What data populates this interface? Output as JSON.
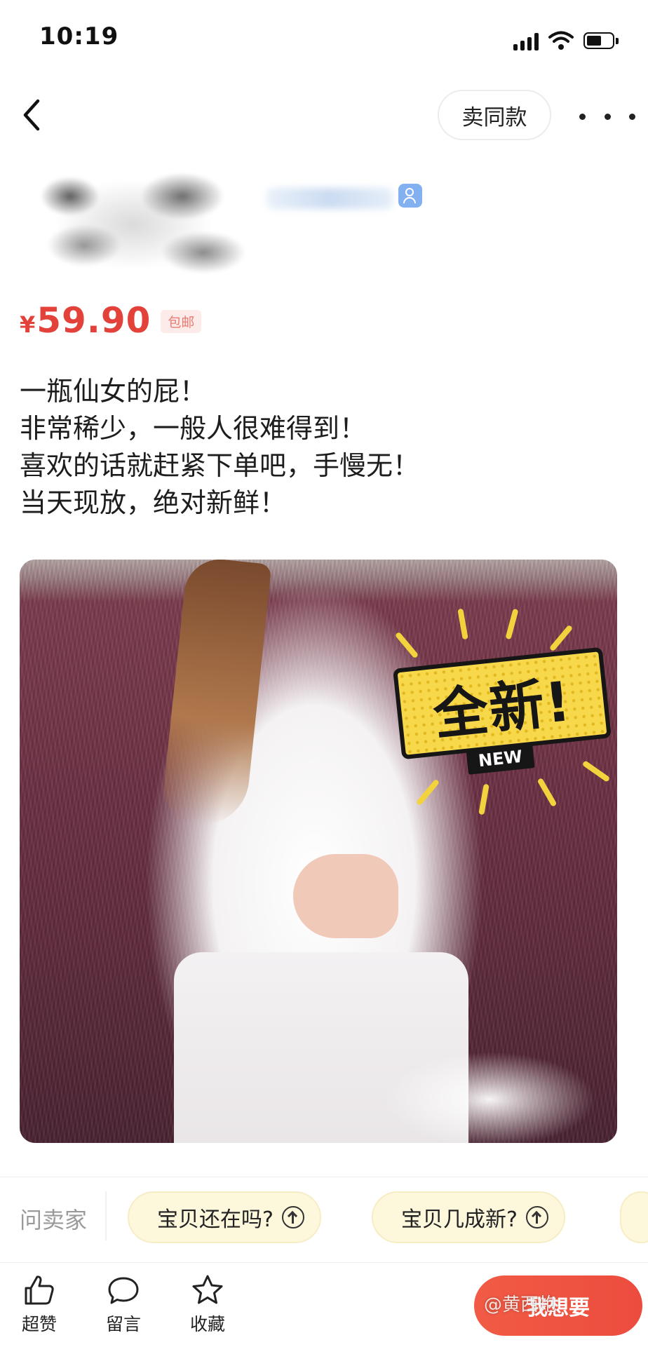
{
  "status_bar": {
    "time": "10:19"
  },
  "nav": {
    "sell_same_label": "卖同款"
  },
  "product": {
    "currency": "¥",
    "price": "59.90",
    "shipping_badge": "包邮",
    "description_lines": [
      "一瓶仙女的屁！",
      "非常稀少，一般人很难得到！",
      "喜欢的话就赶紧下单吧，手慢无！",
      "当天现放，绝对新鲜！"
    ],
    "sticker_text": "全新!",
    "sticker_sub": "NEW"
  },
  "ask_seller": {
    "label": "问卖家",
    "questions": [
      "宝贝还在吗?",
      "宝贝几成新?"
    ]
  },
  "bottom_bar": {
    "like_label": "超赞",
    "comment_label": "留言",
    "favorite_label": "收藏",
    "want_label": "我想要"
  },
  "watermark": "@黄西炮",
  "colors": {
    "price_red": "#e3423b",
    "question_bg": "#fdf7dc",
    "want_button": "#ec4c3e",
    "sticker_yellow": "#f7d84b"
  }
}
